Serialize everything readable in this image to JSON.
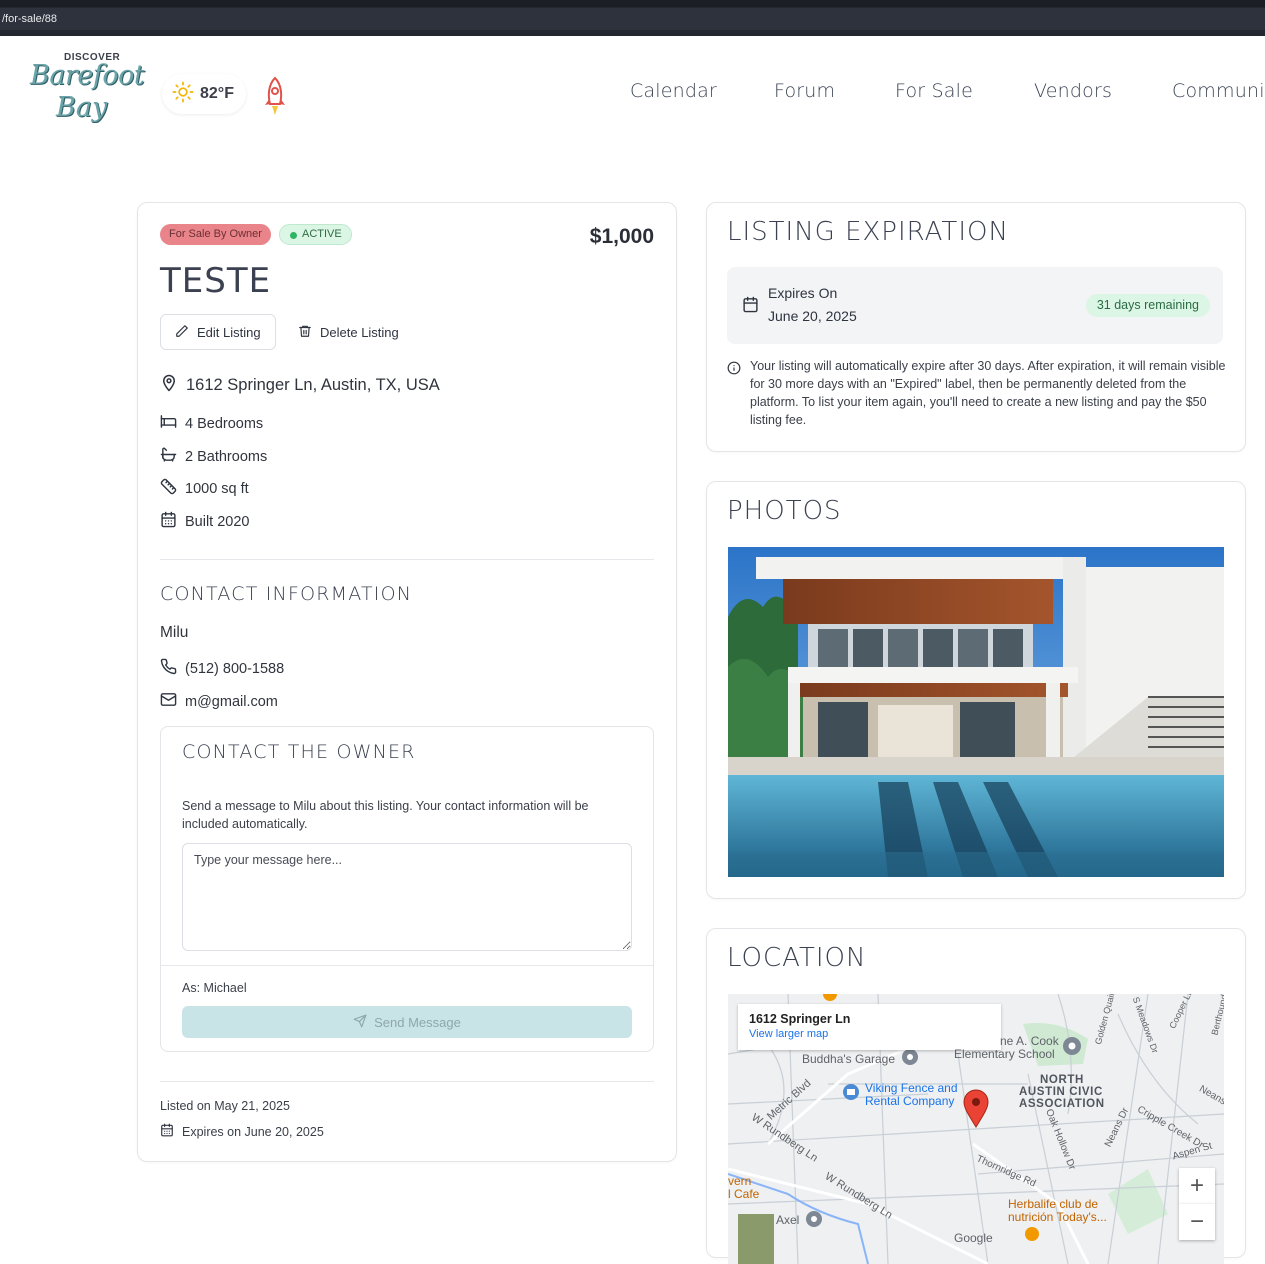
{
  "browser": {
    "url": "/for-sale/88"
  },
  "header": {
    "logo_top": "DISCOVER",
    "logo_line1": "Barefoot",
    "logo_line2": "Bay",
    "weather_temp": "82°F",
    "nav": [
      "Calendar",
      "Forum",
      "For Sale",
      "Vendors",
      "Community"
    ]
  },
  "listing": {
    "badge_type": "For Sale By Owner",
    "badge_status": "ACTIVE",
    "price": "$1,000",
    "title": "TESTE",
    "edit_label": "Edit Listing",
    "delete_label": "Delete Listing",
    "address": "1612 Springer Ln, Austin, TX, USA",
    "bedrooms": "4 Bedrooms",
    "bathrooms": "2 Bathrooms",
    "size": "1000 sq ft",
    "built": "Built 2020"
  },
  "contact": {
    "heading": "CONTACT INFORMATION",
    "name": "Milu",
    "phone": "(512) 800-1588",
    "email": "m@gmail.com"
  },
  "owner_form": {
    "heading": "CONTACT THE OWNER",
    "description": "Send a message to Milu about this listing. Your contact information will be included automatically.",
    "placeholder": "Type your message here...",
    "as_label": "As: Michael",
    "send_label": "Send Message"
  },
  "footer": {
    "listed_on": "Listed on May 21, 2025",
    "expires_on": "Expires on June 20, 2025"
  },
  "expiration": {
    "heading": "LISTING EXPIRATION",
    "label": "Expires On",
    "date": "June 20, 2025",
    "remaining": "31 days remaining",
    "note": "Your listing will automatically expire after 30 days. After expiration, it will remain visible for 30 more days with an \"Expired\" label, then be permanently deleted from the platform. To list your item again, you'll need to create a new listing and pay the $50 listing fee."
  },
  "photos": {
    "heading": "PHOTOS"
  },
  "location": {
    "heading": "LOCATION",
    "map_address": "1612 Springer Ln",
    "map_link": "View larger map",
    "labels": {
      "buddhas": "Buddha's Garage",
      "cook": "ne A. Cook",
      "elem": "Elementary School",
      "viking1": "Viking Fence and",
      "viking2": "Rental Company",
      "north1": "NORTH",
      "north2": "AUSTIN CIVIC",
      "north3": "ASSOCIATION",
      "metric": "Metric Blvd",
      "rundberg1": "W Rundberg Ln",
      "rundberg2": "W Rundberg Ln",
      "thornridge": "Thornridge Rd",
      "oakhollow": "Oak Hollow Dr",
      "neans": "Neans Dr",
      "cripple": "Cripple Creek Dr",
      "aspen": "Aspen St",
      "golden": "Golden Quail Dr",
      "meadows": "S Meadows Dr",
      "cooper": "Cooper Ln",
      "berthound": "Berthound Dr",
      "neans2": "Neans",
      "herbalife1": "Herbalife club de",
      "herbalife2": "nutrición Today's...",
      "axel": "Axel",
      "tavern1": "vern",
      "tavern2": "l Cafe",
      "google": "Google"
    },
    "zoom_in": "+",
    "zoom_out": "−"
  }
}
